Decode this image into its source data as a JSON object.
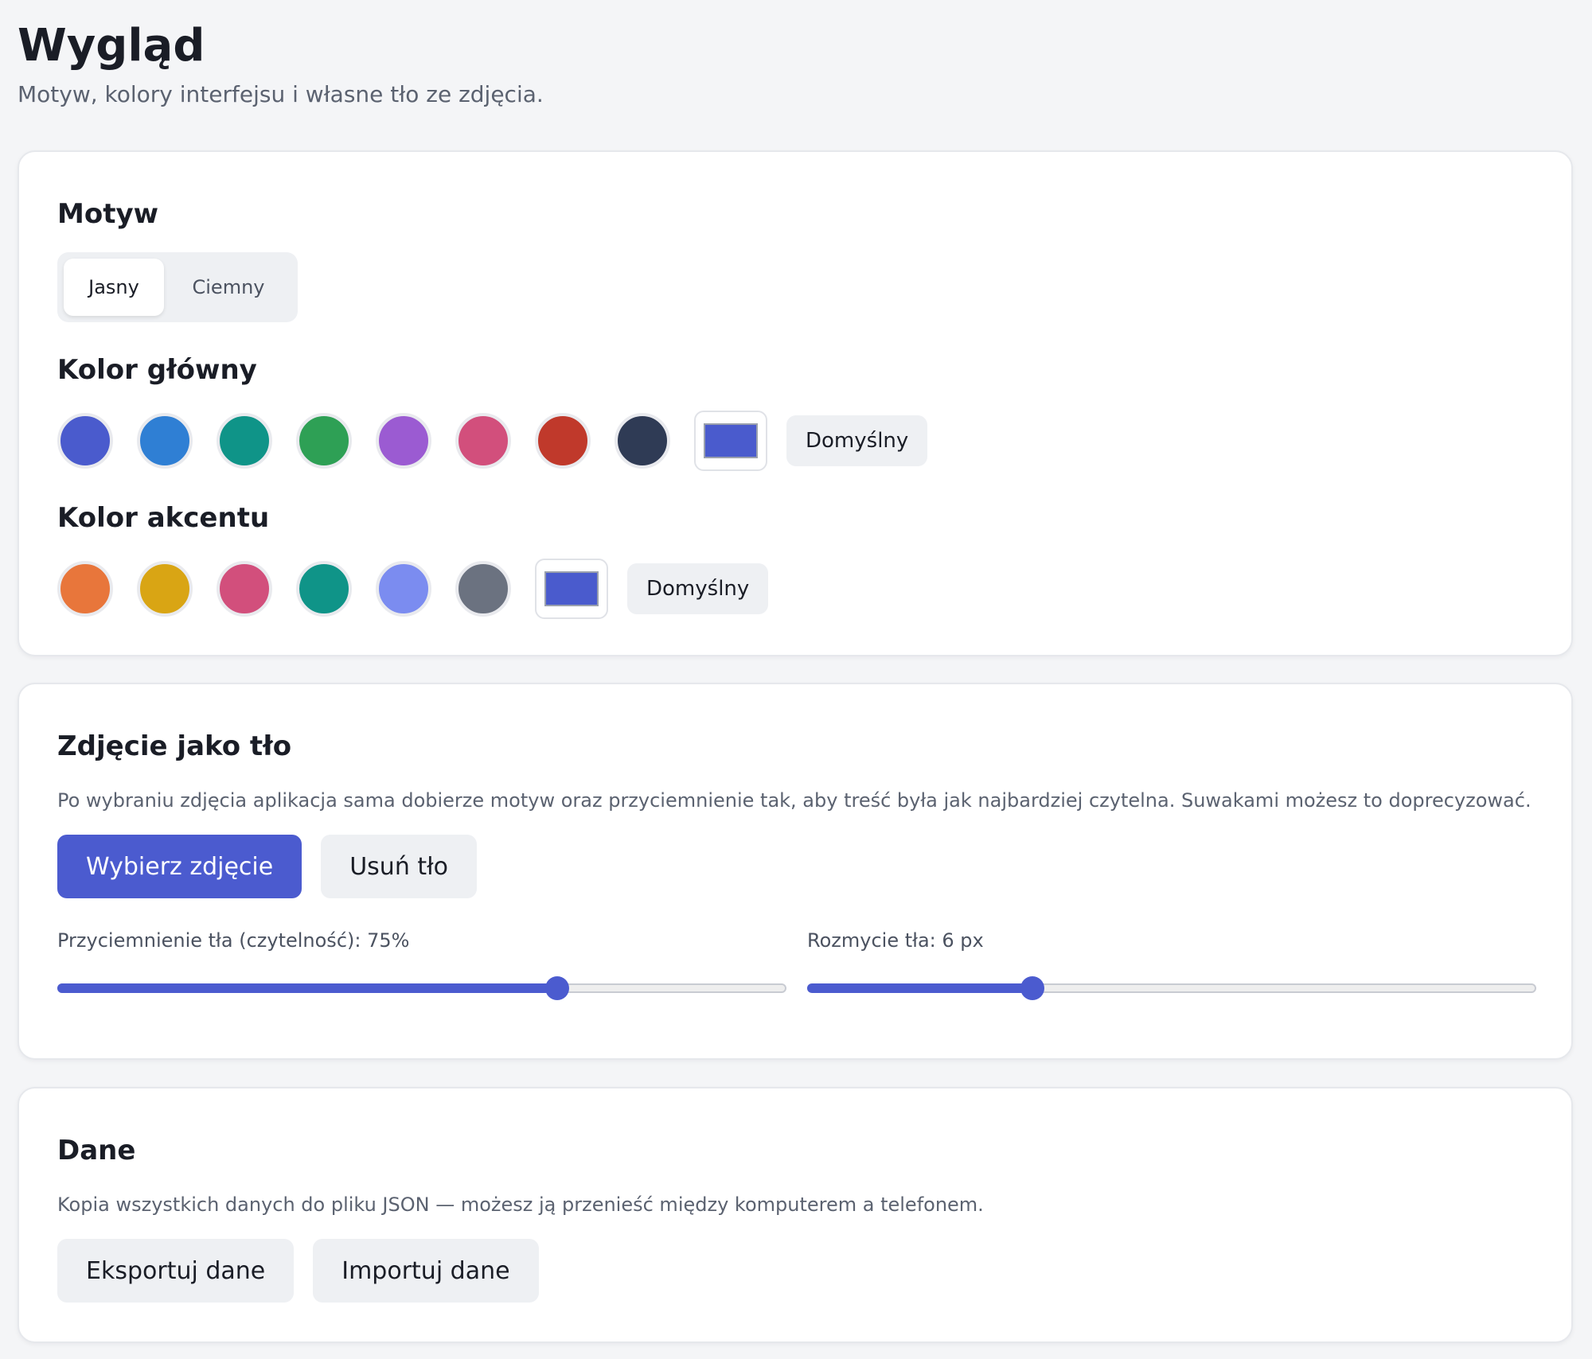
{
  "header": {
    "title": "Wygląd",
    "subtitle": "Motyw, kolory interfejsu i własne tło ze zdjęcia."
  },
  "theme_card": {
    "title": "Motyw",
    "modes": [
      {
        "label": "Jasny",
        "active": true
      },
      {
        "label": "Ciemny",
        "active": false
      }
    ],
    "primary": {
      "title": "Kolor główny",
      "swatches": [
        "#4a5bcd",
        "#2f7fd4",
        "#0f9488",
        "#2ea055",
        "#9b5bd2",
        "#d24f7c",
        "#c0392b",
        "#2f3b55"
      ],
      "custom_color": "#4a5bcd",
      "default_label": "Domyślny"
    },
    "accent": {
      "title": "Kolor akcentu",
      "swatches": [
        "#e8763b",
        "#d9a514",
        "#d24f7c",
        "#0f9488",
        "#7b8cf0",
        "#6b7280"
      ],
      "custom_color": "#4a5bcd",
      "default_label": "Domyślny"
    }
  },
  "background_card": {
    "title": "Zdjęcie jako tło",
    "description": "Po wybraniu zdjęcia aplikacja sama dobierze motyw oraz przyciemnienie tak, aby treść była jak najbardziej czytelna. Suwakami możesz to doprecyzować.",
    "choose_label": "Wybierz zdjęcie",
    "remove_label": "Usuń tło",
    "dim_slider": {
      "label": "Przyciemnienie tła (czytelność): 75%",
      "value_fraction": 0.686
    },
    "blur_slider": {
      "label": "Rozmycie tła: 6 px",
      "value_fraction": 0.309
    }
  },
  "data_card": {
    "title": "Dane",
    "description": "Kopia wszystkich danych do pliku JSON — możesz ją przenieść między komputerem a telefonem.",
    "export_label": "Eksportuj dane",
    "import_label": "Importuj dane"
  },
  "colors": {
    "accent_primary": "#4b5bcf",
    "page_background": "#f4f5f7",
    "card_background": "#ffffff"
  }
}
